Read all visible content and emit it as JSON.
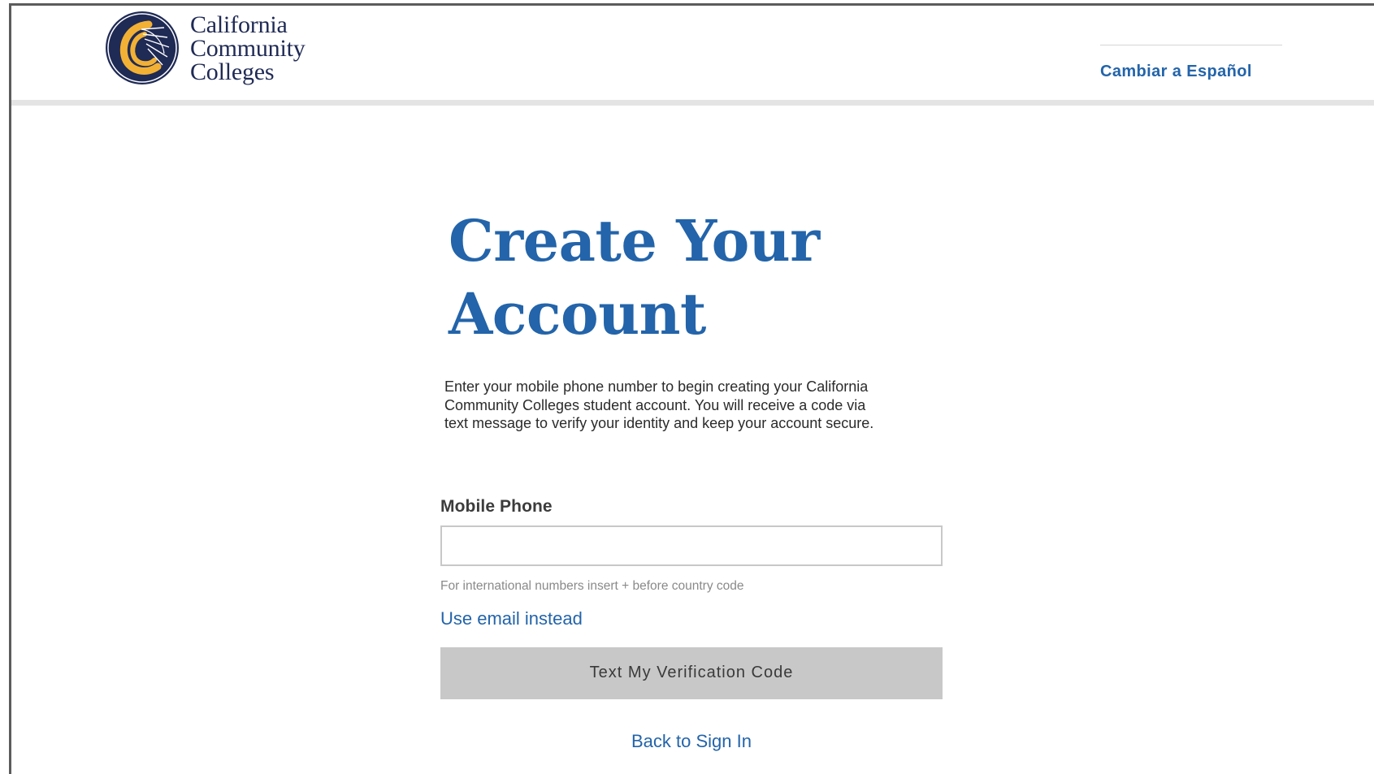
{
  "header": {
    "logo_lines": [
      "California",
      "Community",
      "Colleges"
    ],
    "language_link": "Cambiar a Español"
  },
  "main": {
    "title_line1": "Create Your",
    "title_line2": "Account",
    "intro": "Enter your mobile phone number to begin creating your California Community Colleges student account. You will receive a code via text message to verify your identity and keep your account secure.",
    "phone_label": "Mobile Phone",
    "phone_value": "",
    "phone_hint": "For international numbers insert + before country code",
    "email_link": "Use email instead",
    "submit_button": "Text My Verification Code",
    "back_link": "Back to Sign In"
  },
  "colors": {
    "brand_blue": "#2364aa",
    "logo_navy": "#1f2a55",
    "logo_gold": "#f2b134",
    "button_disabled": "#c8c8c8"
  },
  "icons": {
    "logo": "california-community-colleges-seal-icon"
  }
}
